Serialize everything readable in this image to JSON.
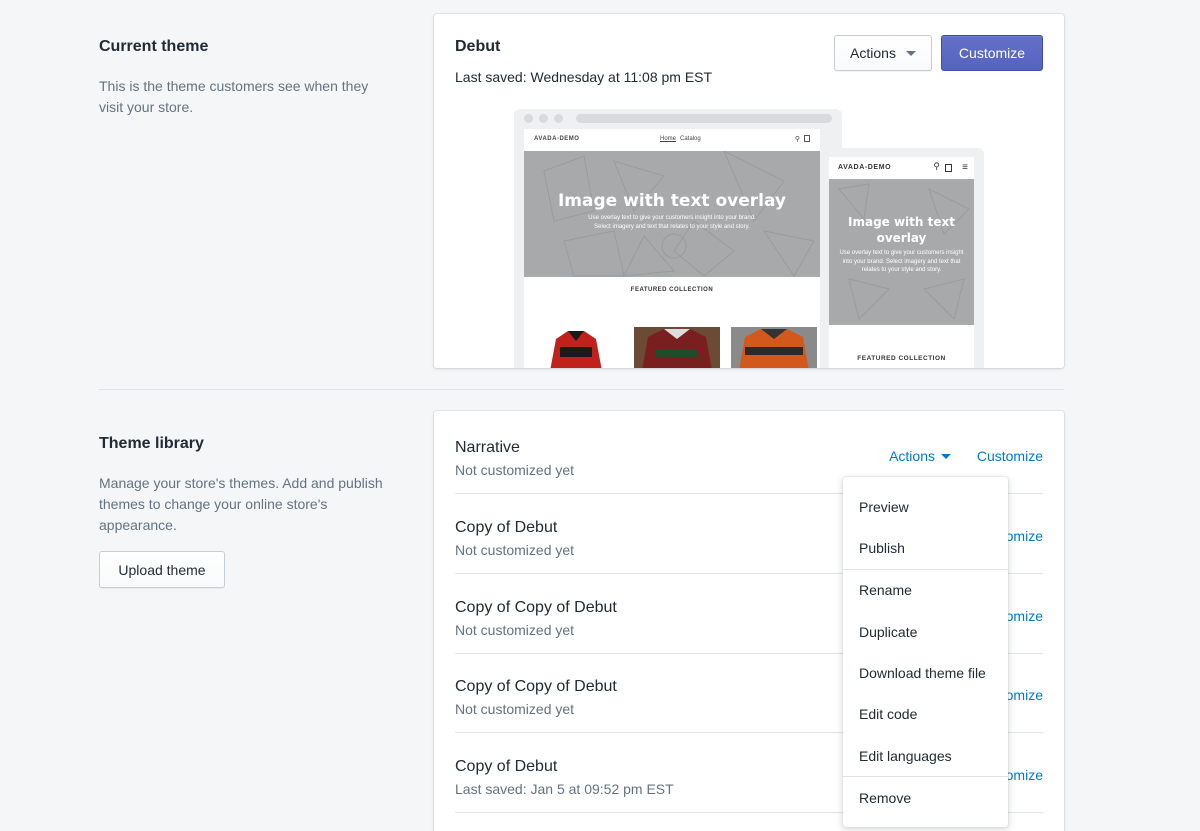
{
  "current_theme_section": {
    "title": "Current theme",
    "description": "This is the theme customers see when they visit your store."
  },
  "current_theme_card": {
    "name": "Debut",
    "last_saved": "Last saved: Wednesday at 11:08 pm EST",
    "actions_label": "Actions",
    "customize_label": "Customize",
    "preview": {
      "desktop_brand": "AVADA-DEMO",
      "desktop_nav": [
        "Home",
        "Catalog"
      ],
      "hero_title": "Image with text overlay",
      "hero_body_desktop": "Use overlay text to give your customers insight into your brand. Select imagery and text that relates to your style and story.",
      "featured_label": "FEATURED COLLECTION",
      "mobile_brand": "AVADA-DEMO",
      "mobile_hero_title": "Image with text overlay",
      "mobile_hero_body": "Use overlay text to give your customers insight into your brand. Select imagery and text that relates to your style and story.",
      "mobile_featured_label": "FEATURED COLLECTION"
    }
  },
  "theme_library_section": {
    "title": "Theme library",
    "description": "Manage your store's themes. Add and publish themes to change your online store's appearance.",
    "upload_label": "Upload theme"
  },
  "library_themes": [
    {
      "name": "Narrative",
      "status": "Not customized yet",
      "actions_label": "Actions",
      "customize_label": "Customize"
    },
    {
      "name": "Copy of Debut",
      "status": "Not customized yet",
      "customize_label": "Customize"
    },
    {
      "name": "Copy of Copy of Debut",
      "status": "Not customized yet",
      "customize_label": "Customize"
    },
    {
      "name": "Copy of Copy of Debut",
      "status": "Not customized yet",
      "customize_label": "Customize"
    },
    {
      "name": "Copy of Debut",
      "status": "Last saved: Jan 5 at 09:52 pm EST",
      "customize_label": "Customize"
    }
  ],
  "actions_menu": {
    "items": [
      "Preview",
      "Publish",
      "Rename",
      "Duplicate",
      "Download theme file",
      "Edit code",
      "Edit languages",
      "Remove"
    ]
  },
  "colors": {
    "primary": "#5c6ac4",
    "link": "#007ace",
    "background": "#f4f6f8",
    "text_subdued": "#637381"
  }
}
